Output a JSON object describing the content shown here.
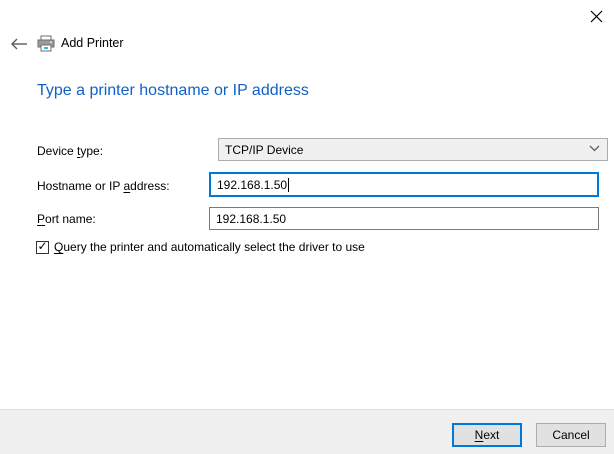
{
  "window": {
    "close_icon": "close"
  },
  "header": {
    "back_icon": "back-arrow",
    "printer_icon": "printer",
    "title": "Add Printer"
  },
  "main": {
    "heading": "Type a printer hostname or IP address"
  },
  "form": {
    "device_type": {
      "label_pre": "Device ",
      "label_key": "t",
      "label_post": "ype:",
      "value": "TCP/IP Device",
      "chevron_icon": "chevron-down"
    },
    "hostname": {
      "label_pre": "Hostname or IP ",
      "label_key": "a",
      "label_post": "ddress:",
      "value": "192.168.1.50",
      "focused": true
    },
    "port_name": {
      "label_pre": "",
      "label_key": "P",
      "label_post": "ort name:",
      "value": "192.168.1.50"
    },
    "query_checkbox": {
      "checked": true,
      "check_glyph": "✓",
      "label_pre": "",
      "label_key": "Q",
      "label_post": "uery the printer and automatically select the driver to use"
    }
  },
  "footer": {
    "next": {
      "label_pre": "",
      "label_key": "N",
      "label_post": "ext"
    },
    "cancel": {
      "label": "Cancel"
    }
  },
  "colors": {
    "heading-blue": "#1060c8",
    "focus-blue": "#0078d7",
    "footer-bg": "#f0f0f0",
    "control-face": "#e1e1e1",
    "control-border": "#adadad",
    "textbox-border": "#7a7a7a",
    "combo-face": "#f0f0f0"
  }
}
